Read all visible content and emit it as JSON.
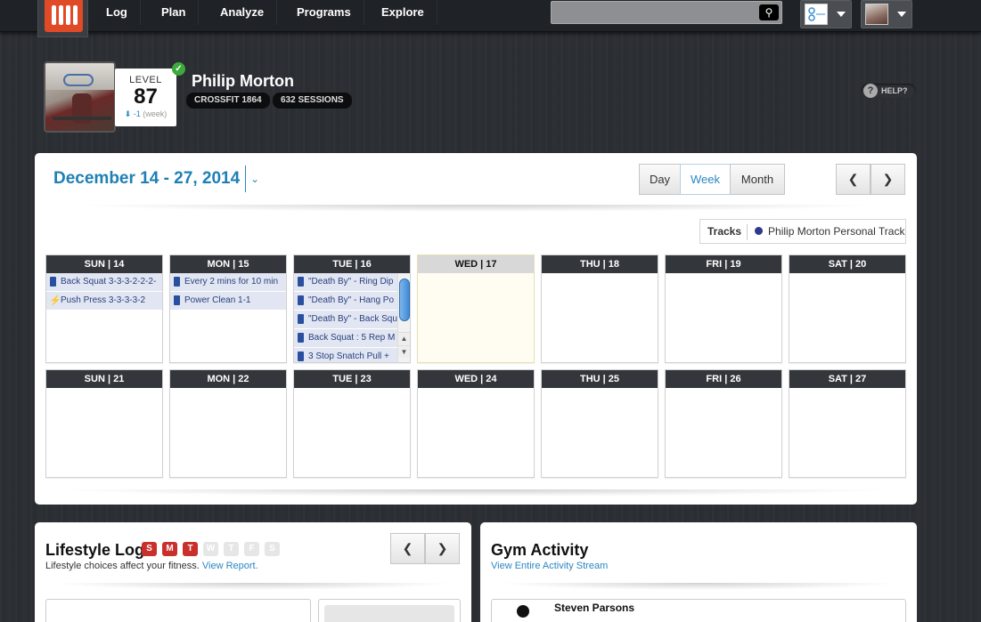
{
  "nav": {
    "items": [
      "Log",
      "Plan",
      "Analyze",
      "Programs",
      "Explore"
    ]
  },
  "profile": {
    "level_label": "LEVEL",
    "level": "87",
    "level_delta": "-1",
    "level_period": "(week)",
    "name": "Philip Morton",
    "badges": [
      "CROSSFIT 1864",
      "632 SESSIONS"
    ],
    "help_label": "HELP?"
  },
  "calendar": {
    "range_title": "December 14 - 27, 2014",
    "views": [
      "Day",
      "Week",
      "Month"
    ],
    "active_view": "Week",
    "prev_label": "‹",
    "next_label": "›",
    "tracks_label": "Tracks",
    "track_name": "Philip Morton Personal Track",
    "track_color": "#2d3a8c",
    "week1": [
      {
        "label": "SUN | 14",
        "entries": [
          {
            "text": "Back Squat 3-3-3-2-2-2-",
            "icon": "pin-icon"
          },
          {
            "text": "Push Press 3-3-3-3-2",
            "icon": "bolt-icon"
          }
        ]
      },
      {
        "label": "MON | 15",
        "entries": [
          {
            "text": "Every 2 mins for 10 min",
            "icon": "pin-icon"
          },
          {
            "text": "Power Clean 1-1",
            "icon": "pin-icon"
          }
        ]
      },
      {
        "label": "TUE | 16",
        "entries": [
          {
            "text": "\"Death By\" - Ring Dip",
            "icon": "pin-icon"
          },
          {
            "text": "\"Death By\" - Hang Po",
            "icon": "pin-icon"
          },
          {
            "text": "\"Death By\" - Back Squ",
            "icon": "pin-icon"
          },
          {
            "text": "Back Squat : 5 Rep M",
            "icon": "pin-icon"
          },
          {
            "text": "3 Stop Snatch Pull +",
            "icon": "pin-icon"
          }
        ]
      },
      {
        "label": "WED | 17",
        "entries": []
      },
      {
        "label": "THU | 18",
        "entries": []
      },
      {
        "label": "FRI | 19",
        "entries": []
      },
      {
        "label": "SAT | 20",
        "entries": []
      }
    ],
    "week2": [
      "SUN | 21",
      "MON | 22",
      "TUE | 23",
      "WED | 24",
      "THU | 25",
      "FRI | 26",
      "SAT | 27"
    ]
  },
  "lifestyle": {
    "title": "Lifestyle Log",
    "days": [
      "S",
      "M",
      "T",
      "W",
      "T",
      "F",
      "S"
    ],
    "active_days": [
      true,
      true,
      true,
      false,
      false,
      false,
      false
    ],
    "subtitle": "Lifestyle choices affect your fitness.",
    "report_link": "View Report."
  },
  "gym": {
    "title": "Gym Activity",
    "stream_link": "View Entire Activity Stream",
    "first_user": "Steven Parsons"
  },
  "colors": {
    "accent": "#2a86c2",
    "brand": "#e04a26",
    "active_day": "#c9302c"
  }
}
